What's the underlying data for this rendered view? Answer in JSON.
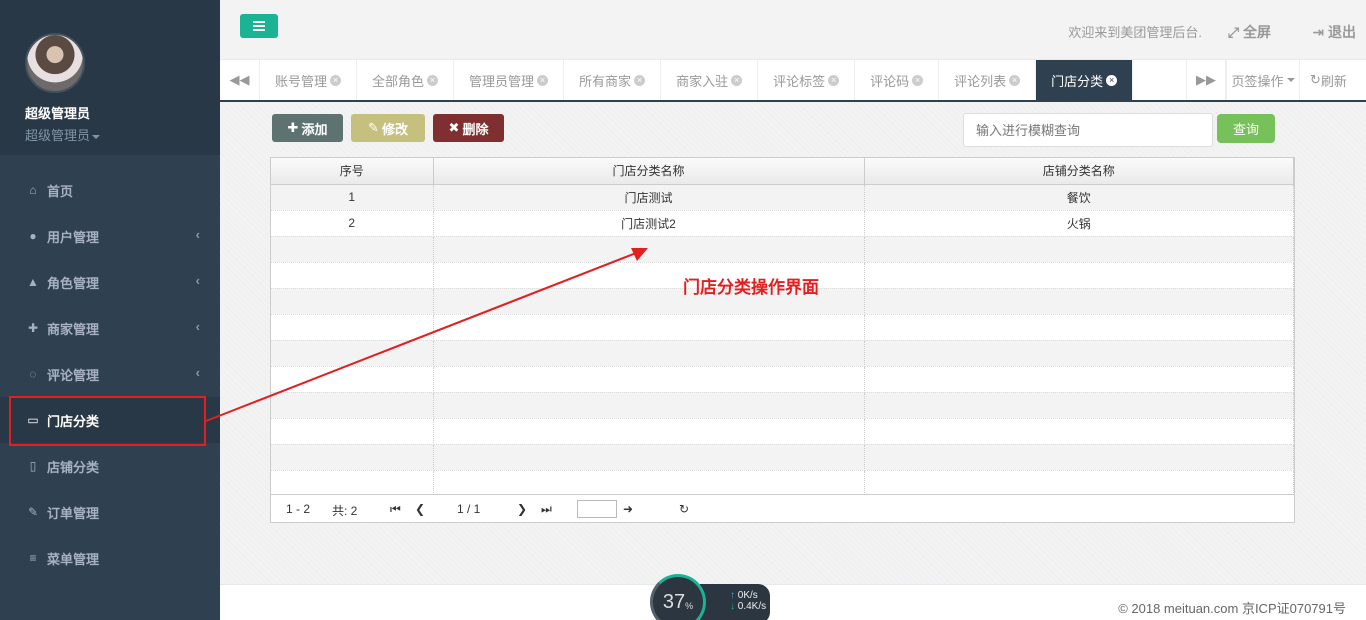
{
  "sidebar": {
    "user_name": "超级管理员",
    "user_role": "超级管理员",
    "items": [
      {
        "label": "首页",
        "icon": "home-icon"
      },
      {
        "label": "用户管理",
        "icon": "user-icon"
      },
      {
        "label": "角色管理",
        "icon": "flask-icon"
      },
      {
        "label": "商家管理",
        "icon": "users-icon"
      },
      {
        "label": "评论管理",
        "icon": "comment-icon"
      },
      {
        "label": "门店分类",
        "icon": "desktop-icon"
      },
      {
        "label": "店铺分类",
        "icon": "book-icon"
      },
      {
        "label": "订单管理",
        "icon": "edit-icon"
      },
      {
        "label": "菜单管理",
        "icon": "list-icon"
      }
    ]
  },
  "header": {
    "welcome": "欢迎来到美团管理后台.",
    "fullscreen": "全屏",
    "logout": "退出"
  },
  "tabs": {
    "items": [
      "账号管理",
      "全部角色",
      "管理员管理",
      "所有商家",
      "商家入驻",
      "评论标签",
      "评论码",
      "评论列表",
      "门店分类"
    ],
    "active": "门店分类",
    "page_op": "页签操作",
    "refresh": "刷新"
  },
  "toolbar": {
    "add": "添加",
    "edit": "修改",
    "delete": "删除",
    "search_placeholder": "输入进行模糊查询",
    "search_button": "查询"
  },
  "table": {
    "headers": [
      "序号",
      "门店分类名称",
      "店铺分类名称"
    ],
    "rows": [
      [
        "1",
        "门店测试",
        "餐饮"
      ],
      [
        "2",
        "门店测试2",
        "火锅"
      ]
    ]
  },
  "pager": {
    "range": "1 - 2",
    "total": "共: 2",
    "page": "1 / 1"
  },
  "annotation": "门店分类操作界面",
  "footer": {
    "copyright": "© 2018 meituan.com 京ICP证070791号",
    "speed_percent": "37",
    "up_speed": "0K/s",
    "down_speed": "0.4K/s"
  },
  "colors": {
    "sidebar_bg": "#2f4050",
    "accent": "#1ab394",
    "annotation": "#e31f1f"
  }
}
